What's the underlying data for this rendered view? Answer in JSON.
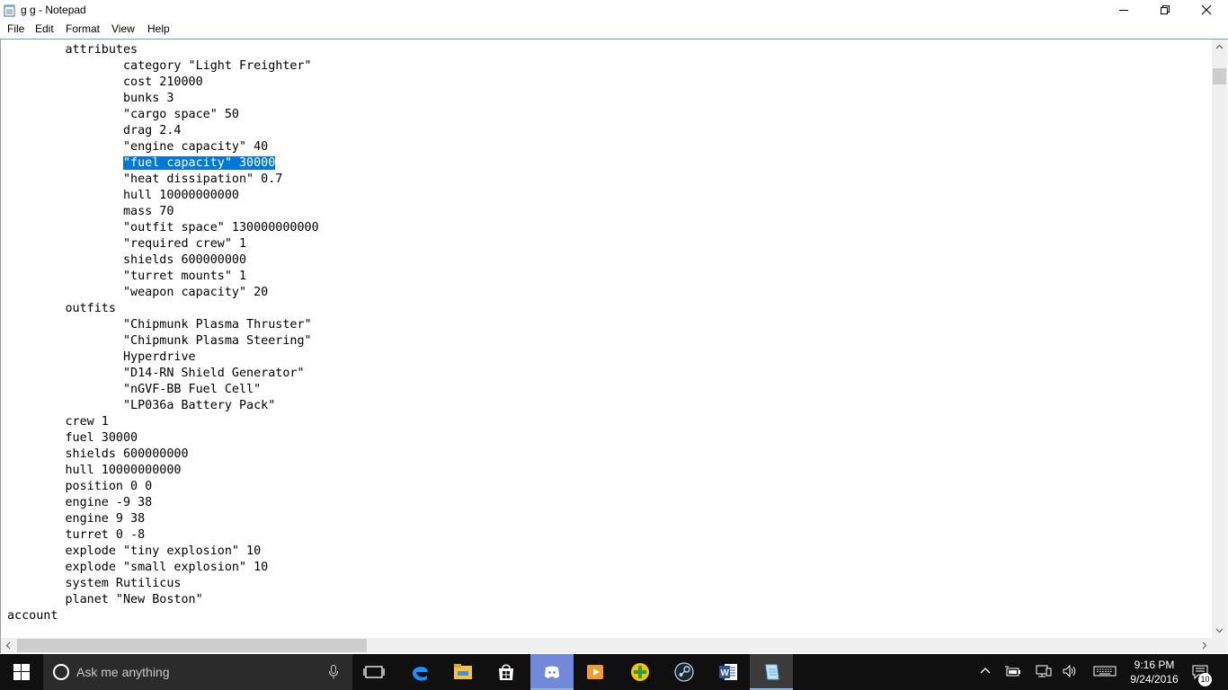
{
  "window": {
    "title": "g g - Notepad",
    "icon": "notepad-icon",
    "controls": [
      "minimize-icon",
      "maximize-icon",
      "close-icon"
    ]
  },
  "menu": {
    "items": [
      "File",
      "Edit",
      "Format",
      "View",
      "Help"
    ]
  },
  "editor": {
    "selected_line_index": 6,
    "lines": [
      "        attributes",
      "                category \"Light Freighter\"",
      "                cost 210000",
      "                bunks 3",
      "                \"cargo space\" 50",
      "                drag 2.4",
      "                \"engine capacity\" 40",
      "                \"fuel capacity\" 30000",
      "                \"heat dissipation\" 0.7",
      "                hull 10000000000",
      "                mass 70",
      "                \"outfit space\" 130000000000",
      "                \"required crew\" 1",
      "                shields 600000000",
      "                \"turret mounts\" 1",
      "                \"weapon capacity\" 20",
      "        outfits",
      "                \"Chipmunk Plasma Thruster\"",
      "                \"Chipmunk Plasma Steering\"",
      "                Hyperdrive",
      "                \"D14-RN Shield Generator\"",
      "                \"nGVF-BB Fuel Cell\"",
      "                \"LP036a Battery Pack\"",
      "        crew 1",
      "        fuel 30000",
      "        shields 600000000",
      "        hull 10000000000",
      "        position 0 0",
      "        engine -9 38",
      "        engine 9 38",
      "        turret 0 -8",
      "        explode \"tiny explosion\" 10",
      "        explode \"small explosion\" 10",
      "        system Rutilicus",
      "        planet \"New Boston\"",
      "account"
    ],
    "selection": {
      "line": 7,
      "text": "\"fuel capacity\" 30000"
    }
  },
  "taskbar": {
    "search_placeholder": "Ask me anything",
    "apps": [
      {
        "name": "task-view-icon"
      },
      {
        "name": "edge-icon"
      },
      {
        "name": "file-explorer-icon"
      },
      {
        "name": "store-icon"
      },
      {
        "name": "discord-icon"
      },
      {
        "name": "media-player-icon"
      },
      {
        "name": "green-plus-app-icon"
      },
      {
        "name": "steam-icon"
      },
      {
        "name": "word-icon"
      },
      {
        "name": "notepad-icon"
      }
    ],
    "clock": {
      "time": "9:16 PM",
      "date": "9/24/2016"
    },
    "notifications_count": "10"
  },
  "colors": {
    "selection": "#0078d7",
    "taskbar": "#101010",
    "search_box": "#2b2b2b",
    "discord": "#7289da"
  }
}
